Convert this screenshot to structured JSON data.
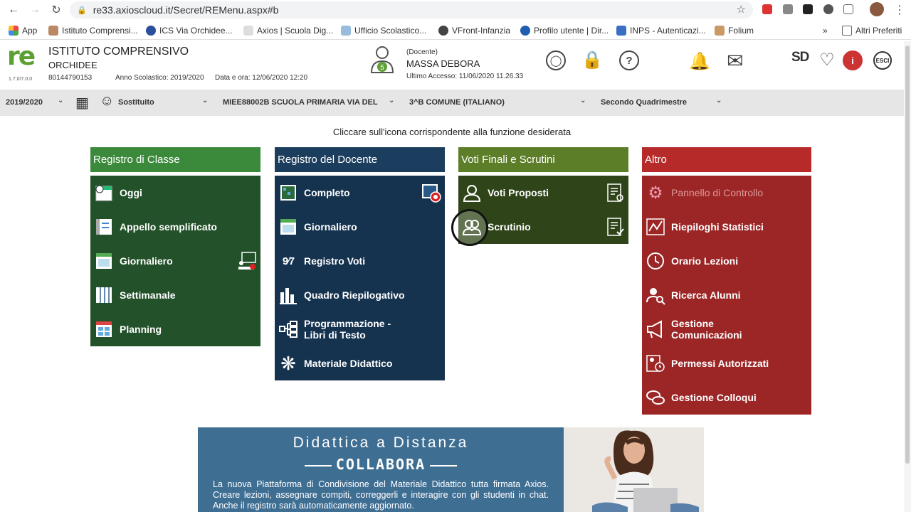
{
  "browser": {
    "url": "re33.axioscloud.it/Secret/REMenu.aspx#b",
    "bookmarks": [
      "App",
      "Istituto Comprensi...",
      "ICS Via Orchidee...",
      "Axios | Scuola Dig...",
      "Ufficio Scolastico...",
      "VFront-Infanzia",
      "Profilo utente | Dir...",
      "INPS - Autenticazi...",
      "Folium"
    ],
    "other_bookmarks": "Altri Preferiti"
  },
  "header": {
    "logo": "re",
    "version": "1.7.0/7.0.0",
    "school_name": "ISTITUTO COMPRENSIVO",
    "school_sub": "ORCHIDEE",
    "school_code": "80144790153",
    "school_year": "Anno Scolastico: 2019/2020",
    "datetime": "Data e ora: 12/06/2020 12:20",
    "avatar_badge": "5",
    "user_role": "(Docente)",
    "user_name": "MASSA DEBORA",
    "last_access": "Ultimo Accesso: 11/06/2020 11.26.33",
    "sd_label": "SD",
    "logout_label": "ESCI"
  },
  "selection": {
    "year": "2019/2020",
    "substitute": "Sostituito",
    "school": "MIEE88002B SCUOLA PRIMARIA VIA DEL",
    "class": "3^B COMUNE (ITALIANO)",
    "period": "Secondo Quadrimestre"
  },
  "instruction": "Cliccare sull'icona corrispondente alla funzione desiderata",
  "panels": {
    "classe": {
      "title": "Registro di Classe",
      "items": [
        "Oggi",
        "Appello semplificato",
        "Giornaliero",
        "Settimanale",
        "Planning"
      ]
    },
    "docente": {
      "title": "Registro del Docente",
      "items": [
        "Completo",
        "Giornaliero",
        "Registro Voti",
        "Quadro Riepilogativo",
        "Programmazione -",
        "Libri di Testo",
        "Materiale Didattico"
      ]
    },
    "voti": {
      "title": "Voti Finali e Scrutini",
      "items": [
        "Voti Proposti",
        "Scrutinio"
      ]
    },
    "altro": {
      "title": "Altro",
      "items": [
        "Pannello di Controllo",
        "Riepiloghi Statistici",
        "Orario Lezioni",
        "Ricerca Alunni",
        "Gestione",
        "Comunicazioni",
        "Permessi Autorizzati",
        "Gestione Colloqui"
      ]
    }
  },
  "banner": {
    "title": "Didattica a Distanza",
    "subtitle": "COLLABORA",
    "text": "La nuova Piattaforma di Condivisione del Materiale Didattico tutta firmata Axios. Creare lezioni, assegnare compiti, correggerli e interagire con gli studenti in chat. Anche il registro sarà automaticamente aggiornato."
  },
  "colors": {
    "green_title": "#3b8a3b",
    "green_body": "#23512a",
    "navy_title": "#1c3e5e",
    "navy_body": "#15324f",
    "olive_title": "#5d7e28",
    "olive_body": "#2f4418",
    "red_title": "#b62a2a",
    "red_body": "#9c2626",
    "logo_green": "#5ca033"
  }
}
